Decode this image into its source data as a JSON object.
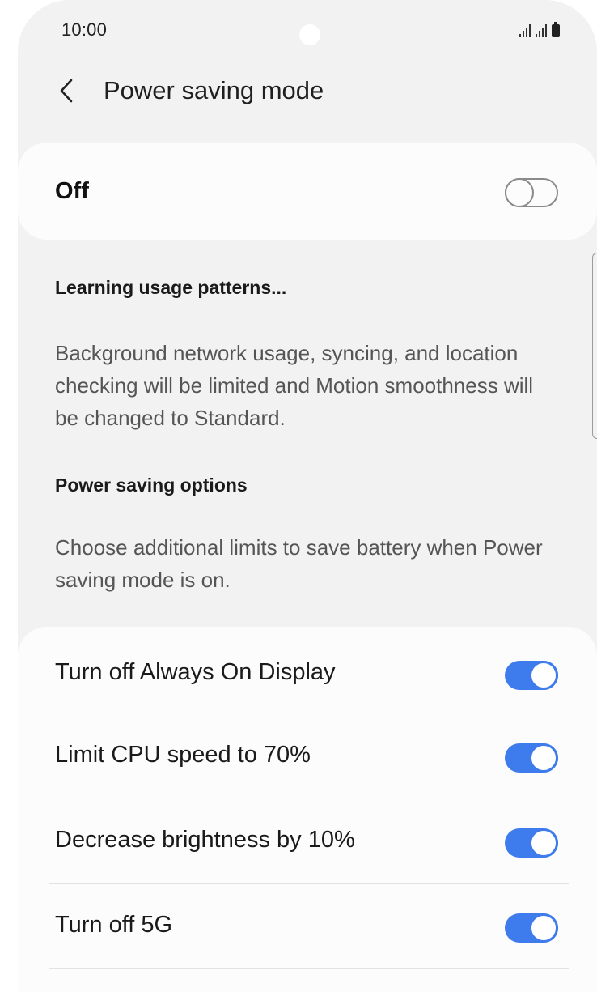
{
  "status_bar": {
    "time": "10:00",
    "icons": [
      "signal-icon",
      "signal-icon",
      "battery-icon"
    ]
  },
  "header": {
    "back_icon": "chevron-left-icon",
    "title": "Power saving mode"
  },
  "master_switch": {
    "label": "Off",
    "state": "off"
  },
  "learning": {
    "heading": "Learning usage patterns...",
    "description": "Background network usage, syncing, and location checking will be limited and Motion smoothness will be changed to Standard."
  },
  "options_section": {
    "heading": "Power saving options",
    "description": "Choose additional limits to save battery when Power saving mode is on."
  },
  "options": [
    {
      "label": "Turn off Always On Display",
      "state": "on"
    },
    {
      "label": "Limit CPU speed to 70%",
      "state": "on"
    },
    {
      "label": "Decrease brightness by 10%",
      "state": "on"
    },
    {
      "label": "Turn off 5G",
      "state": "on"
    }
  ],
  "colors": {
    "accent": "#3e7bed",
    "background": "#f2f2f2",
    "card": "#fcfcfc"
  }
}
